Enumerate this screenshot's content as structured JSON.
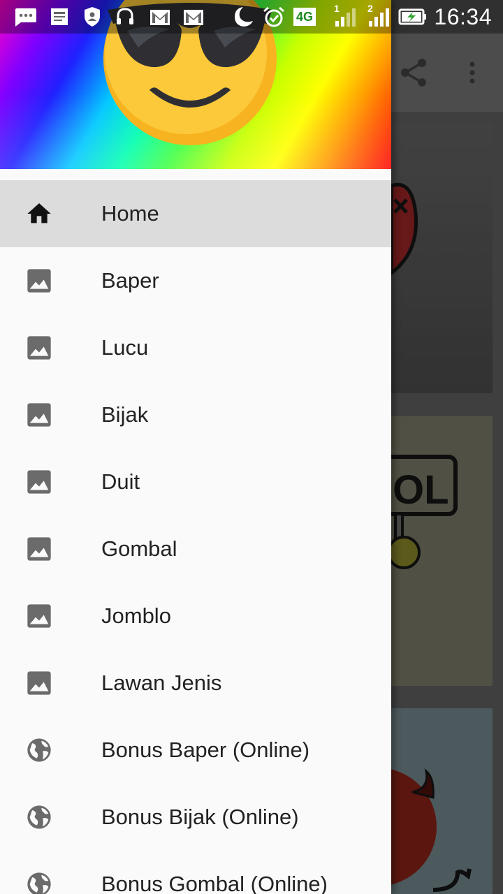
{
  "status_bar": {
    "time": "16:34",
    "network": "4G",
    "sim1": "1",
    "sim2": "2"
  },
  "drawer": {
    "header_image": "sunglasses-emoji",
    "menu": [
      {
        "label": "Home",
        "icon": "home-icon",
        "active": true
      },
      {
        "label": "Baper",
        "icon": "image-icon"
      },
      {
        "label": "Lucu",
        "icon": "image-icon"
      },
      {
        "label": "Bijak",
        "icon": "image-icon"
      },
      {
        "label": "Duit",
        "icon": "image-icon"
      },
      {
        "label": "Gombal",
        "icon": "image-icon"
      },
      {
        "label": "Jomblo",
        "icon": "image-icon"
      },
      {
        "label": "Lawan Jenis",
        "icon": "image-icon"
      },
      {
        "label": "Bonus Baper (Online)",
        "icon": "globe-icon"
      },
      {
        "label": "Bonus Bijak (Online)",
        "icon": "globe-icon"
      },
      {
        "label": "Bonus Gombal (Online)",
        "icon": "globe-icon"
      }
    ]
  },
  "background_app": {
    "toolbar_actions": [
      "share-icon",
      "more-vert-icon"
    ]
  },
  "colors": {
    "drawer_bg": "#fafafa",
    "active_item_bg": "#dcdcdc",
    "icon_gray": "#6b6b6b"
  }
}
